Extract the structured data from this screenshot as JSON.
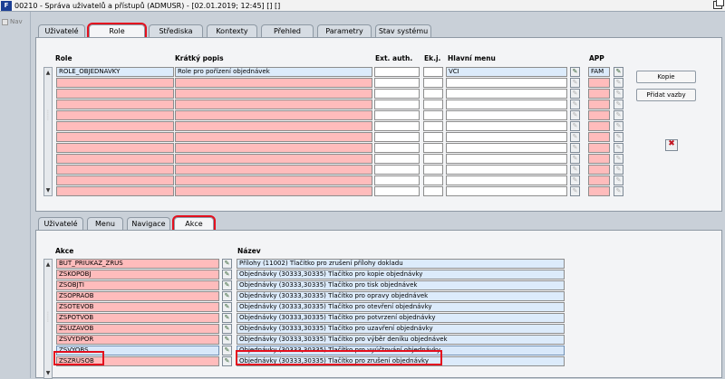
{
  "window": {
    "title": "00210 - Správa uživatelů a přístupů (ADMUSR) - [02.01.2019; 12:45] [] []"
  },
  "nav": {
    "label": "Nav"
  },
  "top_tabs": [
    "Uživatelé",
    "Role",
    "Střediska",
    "Kontexty",
    "Přehled",
    "Parametry",
    "Stav systému"
  ],
  "roles_table": {
    "headers": {
      "role": "Role",
      "desc": "Krátký popis",
      "ext": "Ext. auth.",
      "ekj": "Ek.j.",
      "menu": "Hlavní menu",
      "app": "APP"
    },
    "rows": [
      {
        "role": "ROLE_OBJEDNAVKY",
        "desc": "Role pro pořízení objednávek",
        "ext": "",
        "ekj": "",
        "menu": "VCI",
        "app": "FAM"
      }
    ],
    "empty_rows": 11
  },
  "side_buttons": {
    "kopie": "Kopie",
    "pridat_vazby": "Přidat vazby"
  },
  "bottom_tabs": [
    "Uživatelé",
    "Menu",
    "Navigace",
    "Akce"
  ],
  "actions_table": {
    "headers": {
      "akce": "Akce",
      "nazev": "Název"
    },
    "rows": [
      {
        "akce": "BUT_PRIUKAZ_ZRUS",
        "nazev": "Přílohy (11002) Tlačítko pro zrušení přílohy dokladu"
      },
      {
        "akce": "ZSKOPOBJ",
        "nazev": "Objednávky (30333,30335) Tlačítko pro kopie objednávky"
      },
      {
        "akce": "ZSOBJTI",
        "nazev": "Objednávky (30333,30335) Tlačítko pro tisk objednávek"
      },
      {
        "akce": "ZSOPRAOB",
        "nazev": "Objednávky (30333,30335) Tlačítko pro opravy objednávek"
      },
      {
        "akce": "ZSOTEVOB",
        "nazev": "Objednávky (30333,30335) Tlačítko pro otevření objednávky"
      },
      {
        "akce": "ZSPOTVOB",
        "nazev": "Objednávky (30333,30335) Tlačítko pro potvrzení objednávky"
      },
      {
        "akce": "ZSUZAVOB",
        "nazev": "Objednávky (30333,30335) Tlačítko pro uzavření objednávky"
      },
      {
        "akce": "ZSVYDPOR",
        "nazev": "Objednávky (30333,30335) Tlačítko pro výběr deníku objednávek"
      },
      {
        "akce": "ZSVYOBS",
        "nazev": "Objednávky (30333,30335) Tlačítko pro vyúčtování objednávky"
      },
      {
        "akce": "ZSZRUSOB",
        "nazev": "Objednávky (30333,30335) Tlačítko pro zrušení objednávky"
      }
    ]
  },
  "colors": {
    "required_field": "#ffbcbc",
    "highlight": "#e4101e",
    "selected": "#d8e8fa"
  }
}
